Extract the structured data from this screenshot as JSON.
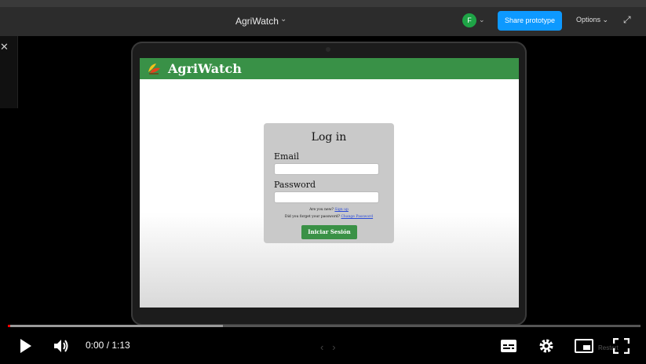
{
  "figma": {
    "title": "AgriWatch",
    "avatar_initial": "F",
    "share_label": "Share prototype",
    "options_label": "Options"
  },
  "app": {
    "brand": "AgriWatch",
    "login": {
      "title": "Log in",
      "email_label": "Email",
      "email_value": "",
      "password_label": "Password",
      "password_value": "",
      "signup_prompt": "Are you new?",
      "signup_link": "Sign up",
      "forgot_prompt": "Did you forget your password?",
      "forgot_link": "Change Password",
      "submit_label": "Iniciar Sesión"
    }
  },
  "player": {
    "time": "0:00 / 1:13",
    "progress": 0.0,
    "buffered": 0.34,
    "restart_label": "Restart"
  },
  "colors": {
    "appbar": "#399147",
    "share": "#0d99ff",
    "progress_played": "#ff0000"
  }
}
